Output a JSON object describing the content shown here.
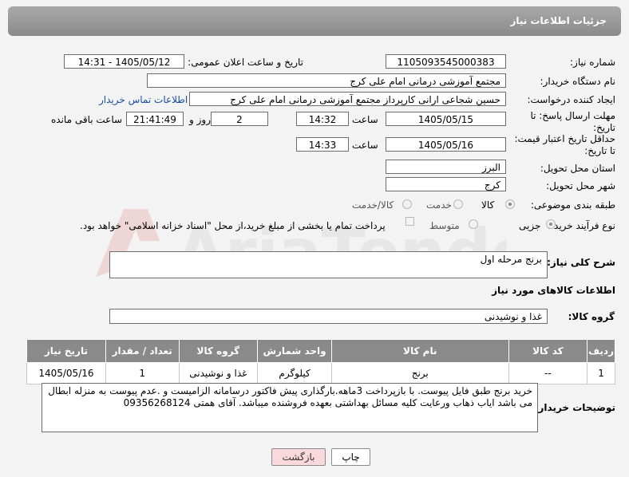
{
  "header": {
    "title": "جزئیات اطلاعات نیاز"
  },
  "fields": {
    "need_number_label": "شماره نیاز:",
    "need_number": "1105093545000383",
    "announce_label": "تاریخ و ساعت اعلان عمومی:",
    "announce_value": "1405/05/12 - 14:31",
    "buyer_org_label": "نام دستگاه خریدار:",
    "buyer_org": "مجتمع آموزشی درمانی امام علی کرج",
    "creator_label": "ایجاد کننده درخواست:",
    "creator": "حسین شجاعی ارانی کارپرداز مجتمع آموزشی درمانی امام علی کرج",
    "contact_link": "اطلاعات تماس خریدار",
    "reply_deadline_label": "مهلت ارسال پاسخ: تا تاریخ:",
    "reply_date": "1405/05/15",
    "time_label": "ساعت",
    "reply_time": "14:32",
    "days_value": "2",
    "days_label": "روز و",
    "remaining_time": "21:41:49",
    "remaining_label": "ساعت باقی مانده",
    "price_deadline_label": "حداقل تاریخ اعتبار قیمت: تا تاریخ:",
    "price_date": "1405/05/16",
    "price_time": "14:33",
    "province_label": "استان محل تحویل:",
    "province": "البرز",
    "city_label": "شهر محل تحویل:",
    "city": "کرج",
    "category_label": "طبقه بندی موضوعی:",
    "category_options": [
      "کالا",
      "خدمت",
      "کالا/خدمت"
    ],
    "process_label": "نوع فرآیند خرید :",
    "process_options": [
      "جزیی",
      "متوسط"
    ],
    "payment_note": "پرداخت تمام یا بخشی از مبلغ خرید،از محل \"اسناد خزانه اسلامی\" خواهد بود.",
    "description_label": "شرح کلی نیاز:",
    "description": "برنج مرحله اول",
    "goods_info_title": "اطلاعات کالاهای مورد نیاز",
    "goods_group_label": "گروه کالا:",
    "goods_group": "غذا و نوشیدنی",
    "buyer_notes_label": "توضیحات خریدار:",
    "buyer_notes": "خرید برنج طبق فایل پیوست. با بازپرداخت 3ماهه.بارگذاری پیش فاکتور درسامانه الزامیست و .عدم پیوست به منزله ابطال می باشد ایاب ذهاب ورعایت کلیه مسائل بهداشتی بعهده فروشنده میباشد. آقای همتی 09356268124"
  },
  "table": {
    "headers": [
      "ردیف",
      "کد کالا",
      "نام کالا",
      "واحد شمارش",
      "گروه کالا",
      "تعداد / مقدار",
      "تاریخ نیاز"
    ],
    "rows": [
      [
        "1",
        "--",
        "برنج",
        "کیلوگرم",
        "غذا و نوشیدنی",
        "1",
        "1405/05/16"
      ]
    ]
  },
  "buttons": {
    "print": "چاپ",
    "back": "بازگشت"
  },
  "watermark": "AriaTender.neT",
  "colors": {
    "header": "#8a8a8a",
    "link": "#1a4fa0",
    "back_button": "#f9d9dc"
  }
}
